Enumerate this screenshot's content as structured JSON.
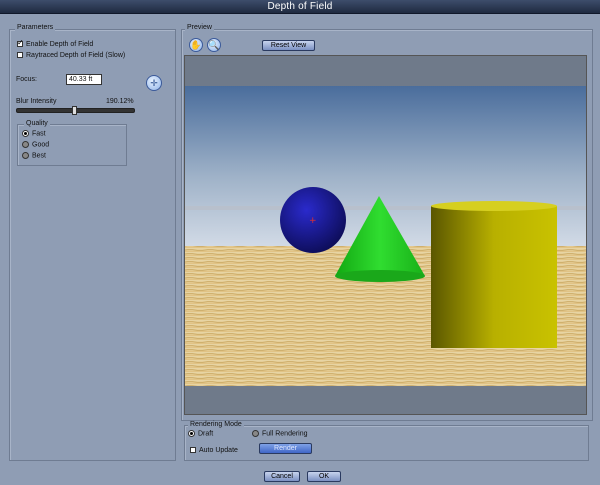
{
  "window": {
    "title": "Depth of Field"
  },
  "parameters": {
    "group_label": "Parameters",
    "enable_dof": {
      "label": "Enable Depth of Field",
      "checked": true
    },
    "raytraced_dof": {
      "label": "Raytraced Depth of Field (Slow)",
      "checked": false
    },
    "focus": {
      "label": "Focus:",
      "value": "40.33 ft"
    },
    "blur": {
      "label": "Blur Intensity",
      "value": "190.12%",
      "level": 0.5
    },
    "quality": {
      "label": "Quality",
      "options": [
        "Fast",
        "Good",
        "Best"
      ],
      "selected": "Fast"
    }
  },
  "preview": {
    "group_label": "Preview",
    "reset_view_label": "Reset View",
    "tools": [
      "hand-tool-icon",
      "zoom-tool-icon"
    ],
    "scene_colors": {
      "sky_top": "#4d6f9a",
      "sky_bottom": "#c7d2e0",
      "floor": "#e0c98a",
      "sphere": "#1a1a9c",
      "cone": "#20c020",
      "cylinder": "#c8c000"
    }
  },
  "rendering_mode": {
    "label": "Rendering Mode",
    "draft_label": "Draft",
    "full_label": "Full Rendering",
    "selected": "Draft",
    "auto_update_label": "Auto Update",
    "render_label": "Render"
  },
  "footer": {
    "cancel_label": "Cancel",
    "ok_label": "OK"
  }
}
